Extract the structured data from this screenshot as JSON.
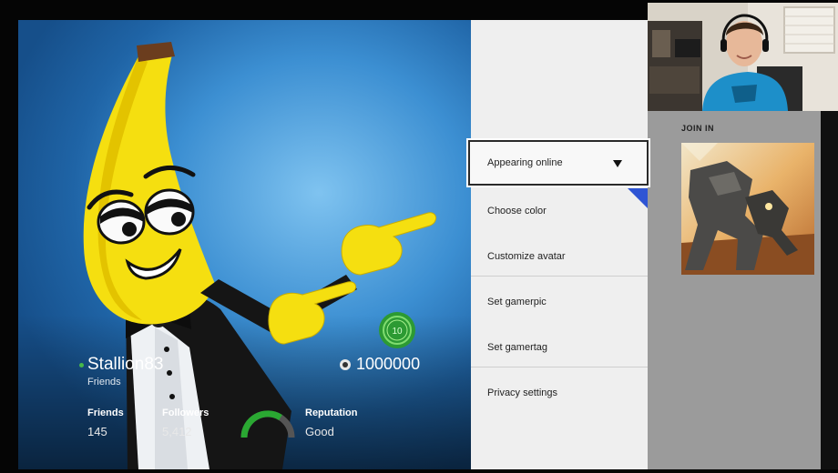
{
  "profile": {
    "gamertag": "Stallion83",
    "relationship": "Friends",
    "gamerscore": "1000000",
    "level": "10",
    "stats": {
      "friends_label": "Friends",
      "friends_value": "145",
      "followers_label": "Followers",
      "followers_value": "5,412",
      "reputation_label": "Reputation",
      "reputation_value": "Good"
    }
  },
  "menu": {
    "items": [
      {
        "label": "Appearing online"
      },
      {
        "label": "Choose color"
      },
      {
        "label": "Customize avatar"
      },
      {
        "label": "Set gamerpic"
      },
      {
        "label": "Set gamertag"
      },
      {
        "label": "Privacy settings"
      }
    ]
  },
  "join_in": {
    "title": "JOIN IN"
  },
  "colors": {
    "xbox_green": "#47b84a",
    "accent_blue": "#2f55d4",
    "menu_bg": "#efefef",
    "panel_gray": "#9b9b9b"
  },
  "icons": {
    "gamerscore": "gamerscore-icon",
    "dropdown": "caret-down-icon",
    "level": "level-badge-icon"
  }
}
